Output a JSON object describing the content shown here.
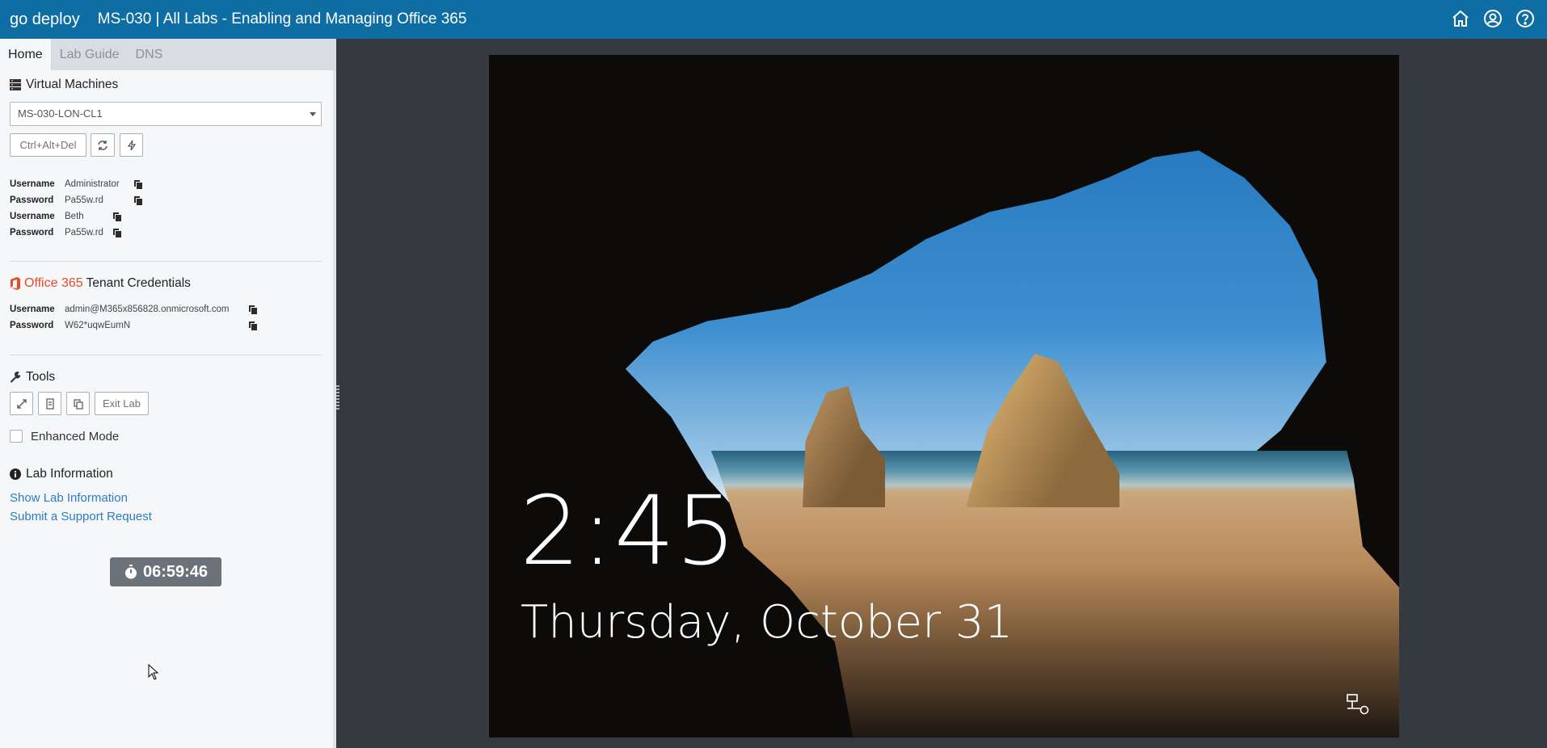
{
  "header": {
    "brand": "go deploy",
    "lab_title": "MS-030 | All Labs - Enabling and Managing Office 365"
  },
  "tabs": [
    "Home",
    "Lab Guide",
    "DNS"
  ],
  "virtual_machines": {
    "heading": "Virtual Machines",
    "selected": "MS-030-LON-CL1",
    "ctrl_alt_del": "Ctrl+Alt+Del",
    "credentials": [
      {
        "key": "Username",
        "value": "Administrator"
      },
      {
        "key": "Password",
        "value": "Pa55w.rd"
      },
      {
        "key": "Username",
        "value": "Beth"
      },
      {
        "key": "Password",
        "value": "Pa55w.rd"
      }
    ]
  },
  "tenant": {
    "brand": "Office 365",
    "heading": "Tenant Credentials",
    "credentials": [
      {
        "key": "Username",
        "value": "admin@M365x856828.onmicrosoft.com"
      },
      {
        "key": "Password",
        "value": "W62*uqwEumN"
      }
    ]
  },
  "tools": {
    "heading": "Tools",
    "exit_lab": "Exit Lab",
    "enhanced_mode": "Enhanced Mode",
    "enhanced_mode_checked": false
  },
  "lab_info": {
    "heading": "Lab Information",
    "show": "Show Lab Information",
    "support": "Submit a Support Request"
  },
  "timer": "06:59:46",
  "lock_screen": {
    "time": "2:45",
    "date": "Thursday, October 31"
  },
  "colors": {
    "header": "#0e6ea3",
    "link": "#2d7cc2",
    "office": "#e34c26",
    "timer": "#6b7279"
  }
}
